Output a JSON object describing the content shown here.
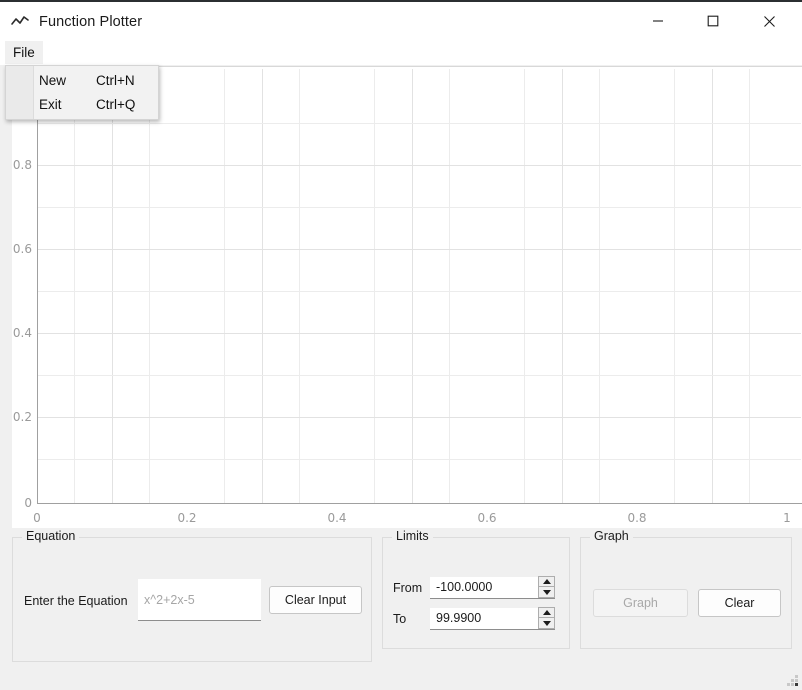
{
  "window": {
    "title": "Function Plotter",
    "icon": "line-chart-icon",
    "controls": {
      "minimize": "minimize-icon",
      "maximize": "maximize-icon",
      "close": "close-icon"
    }
  },
  "menubar": {
    "items": [
      {
        "label": "File"
      }
    ],
    "open_menu": {
      "name": "File",
      "items": [
        {
          "label": "New",
          "accelerator": "Ctrl+N"
        },
        {
          "label": "Exit",
          "accelerator": "Ctrl+Q"
        }
      ]
    }
  },
  "chart_data": {
    "type": "line",
    "title": "",
    "xlabel": "",
    "ylabel": "",
    "xlim": [
      0,
      1
    ],
    "ylim": [
      0,
      1
    ],
    "x_ticks": [
      "0",
      "0.2",
      "0.4",
      "0.6",
      "0.8",
      "1"
    ],
    "x_tick_values": [
      0,
      0.2,
      0.4,
      0.6,
      0.8,
      1
    ],
    "y_ticks": [
      "0",
      "0.2",
      "0.4",
      "0.6",
      "0.8"
    ],
    "y_tick_values": [
      0,
      0.2,
      0.4,
      0.6,
      0.8
    ],
    "grid": true,
    "minor_grid": true,
    "series": [],
    "background": "#ffffff",
    "grid_color": "#e6e6e6"
  },
  "equation_group": {
    "title": "Equation",
    "field_label": "Enter the Equation",
    "input": {
      "value": "",
      "placeholder": "x^2+2x-5"
    },
    "clear_button": "Clear Input"
  },
  "limits_group": {
    "title": "Limits",
    "from": {
      "label": "From",
      "value": "-100.0000"
    },
    "to": {
      "label": "To",
      "value": "99.9900"
    }
  },
  "graph_group": {
    "title": "Graph",
    "graph_button": {
      "label": "Graph",
      "enabled": false
    },
    "clear_button": {
      "label": "Clear",
      "enabled": true
    }
  },
  "colors": {
    "window_bg": "#f0f0f0",
    "titlebar_bg": "#ffffff",
    "plot_bg": "#ffffff",
    "grid": "#e6e6e6",
    "axis": "#9a9a9a",
    "text": "#1b1b1b",
    "muted_text": "#a6a6a6"
  }
}
